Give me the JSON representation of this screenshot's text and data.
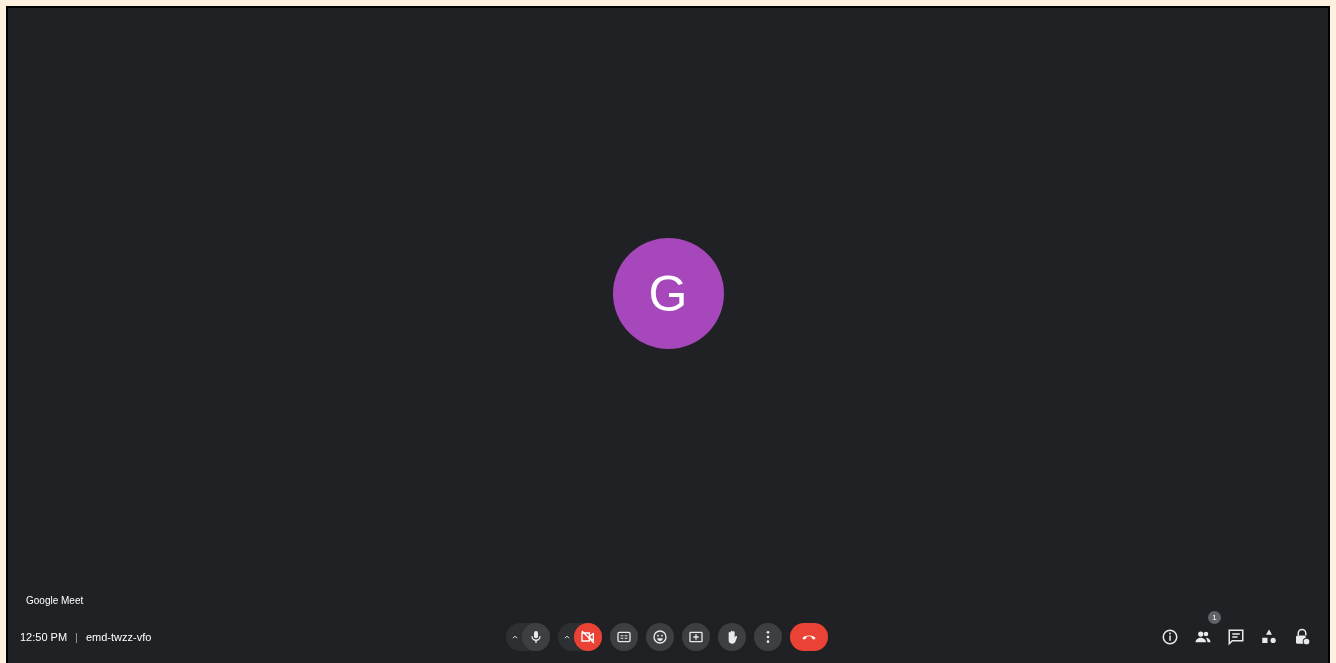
{
  "avatar": {
    "letter": "G",
    "color": "#a647bb"
  },
  "app_label": "Google Meet",
  "meeting": {
    "time": "12:50 PM",
    "separator": "|",
    "code": "emd-twzz-vfo"
  },
  "controls": [
    {
      "kind": "mic",
      "muted": false
    },
    {
      "kind": "camera",
      "muted": true
    },
    {
      "kind": "captions"
    },
    {
      "kind": "emoji"
    },
    {
      "kind": "present"
    },
    {
      "kind": "hand"
    },
    {
      "kind": "more"
    },
    {
      "kind": "end_call"
    }
  ],
  "side_buttons": [
    {
      "kind": "info"
    },
    {
      "kind": "people",
      "badge": "1"
    },
    {
      "kind": "chat"
    },
    {
      "kind": "activities"
    },
    {
      "kind": "host"
    }
  ]
}
